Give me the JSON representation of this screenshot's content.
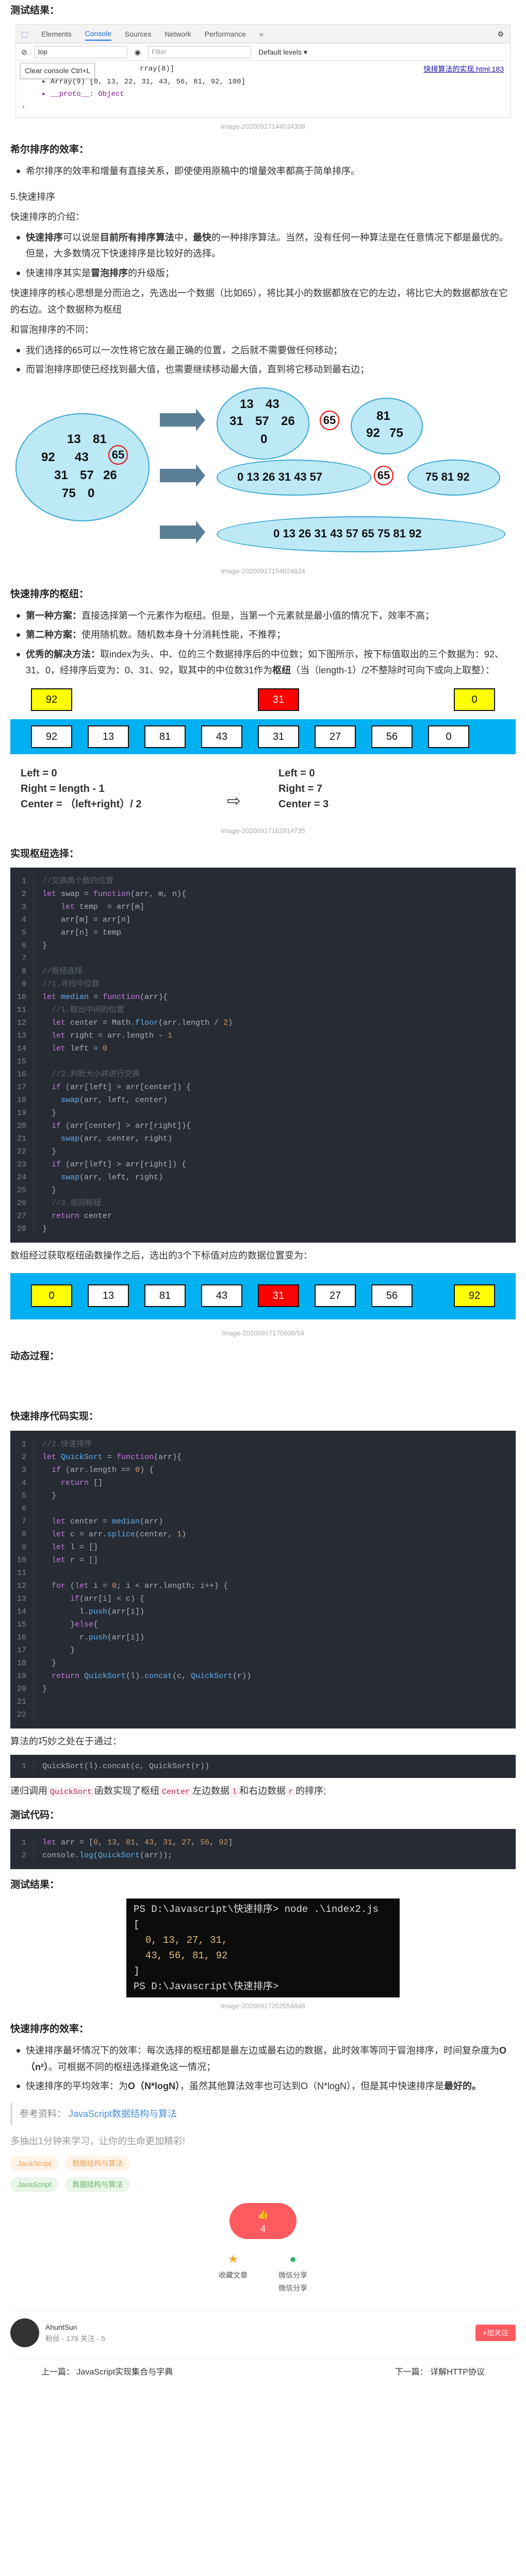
{
  "header": {
    "top_title": "测试结果："
  },
  "devtools": {
    "tabs": [
      "Elements",
      "Console",
      "Sources",
      "Network",
      "Performance"
    ],
    "more": "»",
    "context": "top",
    "filter_placeholder": "Filter",
    "levels": "Default levels ▾",
    "tooltip": "Clear console  Ctrl+L",
    "array_line": "▸ Array(9) [0, 13, 22, 31, 43, 56, 81, 92, 100]",
    "frag_top": "rray(8)]",
    "link": "快排算法的实现.html:183",
    "proto": "▸ __proto__: Object",
    "arrow": "›"
  },
  "cap1": "Image-20200917144534308",
  "s_heap": {
    "title": "希尔排序的效率：",
    "item": "希尔排序的效率和增量有直接关系，即使使用原稿中的增量效率都高于简单排序。"
  },
  "s_quick": {
    "title": "5.快速排序",
    "intro": "快速排序的介绍：",
    "b1a": "快速排序",
    "b1b": "可以说是",
    "b1c": "目前所有排序算法",
    "b1d": "中，",
    "b1e": "最快",
    "b1f": "的一种排序算法。当然，没有任何一种算法是在任意情况下都是最优的。但是，大多数情况下快速排序是比较好的选择。",
    "b2a": "快速排序其实是",
    "b2b": "冒泡排序",
    "b2c": "的升级版；",
    "p1": "快速排序的核心思想是分而治之，先选出一个数据（比如65），将比其小的数据都放在它的左边，将比它大的数据都放在它的右边。这个数据称为枢纽",
    "diff": "和冒泡排序的不同：",
    "d1": "我们选择的65可以一次性将它放在最正确的位置，之后就不需要做任何移动；",
    "d2": "而冒泡排序即使已经找到最大值，也需要继续移动最大值，直到将它移动到最右边；"
  },
  "heap_fig": {
    "g1": [
      "13",
      "81",
      "92",
      "43",
      "65",
      "31",
      "57",
      "26",
      "75",
      "0"
    ],
    "g2a": [
      "13",
      "43",
      "31",
      "57",
      "26",
      "0"
    ],
    "c1": "65",
    "g2b": [
      "81",
      "92",
      "75"
    ],
    "g3a": "0 13 26 31 43 57",
    "c2": "65",
    "g3b": "75 81 92",
    "g4": "0 13 26 31 43 57 65 75 81 92"
  },
  "cap2": "Image-20200917154024624",
  "s_pivot": {
    "title": "快速排序的枢纽：",
    "i1a": "第一种方案：",
    "i1b": "直接选择第一个元素作为枢纽。但是，当第一个元素就是最小值的情况下，效率不高；",
    "i2a": "第二种方案：",
    "i2b": "使用随机数。随机数本身十分消耗性能，不推荐；",
    "i3a": "优秀的解决方法：",
    "i3b": "取index为头、中、位的三个数据排序后的中位数；如下图所示，按下标值取出的三个数据为：92、31、0，经排序后变为：0、31、92，取其中的中位数31作为",
    "i3c": "枢纽",
    "i3d": "（当（length-1）/2不整除时可向下或向上取整）："
  },
  "box_fig": {
    "top": [
      "92",
      "31",
      "0"
    ],
    "row": [
      "92",
      "13",
      "81",
      "43",
      "31",
      "27",
      "56",
      "0"
    ],
    "left": [
      "Left = 0",
      "Right = length - 1",
      "Center = （left+right）/ 2"
    ],
    "right": [
      "Left = 0",
      "Right = 7",
      "Center = 3"
    ]
  },
  "cap3": "Image-20200917162914735",
  "s_impl": {
    "title": "实现枢纽选择："
  },
  "cap_row": "Image-20200917170908/54",
  "s_impl2": {
    "p": "数组经过获取枢纽函数操作之后，选出的3个下标值对应的数据位置变为：",
    "row2": [
      "0",
      "13",
      "81",
      "43",
      "31",
      "27",
      "56",
      "92"
    ]
  },
  "s_anim": {
    "title": "动态过程：",
    "title2": "快速排序代码实现："
  },
  "s_ret": {
    "p": "算法的巧妙之处在于通过：",
    "code": "QuickSort(l).concat(c, QuickSort(r))",
    "p2a": "递归调用",
    "p2b": "QuickSort",
    "p2c": "函数实现了枢纽",
    "p2d": "Center",
    "p2e": "左边数据",
    "p2f": "l",
    "p2g": "和右边数据",
    "p2h": "r",
    "p2i": "的排序;"
  },
  "s_test": {
    "title": "测试代码：",
    "title2": "测试结果："
  },
  "term": {
    "l1": "PS D:\\Javascript\\快速排序> node .\\index2.js",
    "l2": "[",
    "l3": "  0, 13, 27, 31,",
    "l4": "  43, 56, 81, 92",
    "l5": "]",
    "l6": "PS D:\\Javascript\\快速排序> "
  },
  "cap4": "Image-20200917202554848",
  "s_eff": {
    "title": "快速排序的效率：",
    "i1a": "快速排序最坏情况下的效率：每次选择的枢纽都是最左边或最右边的数据，此时效率等同于冒泡排序，时间复杂度为",
    "i1b": "O（n²）",
    "i1c": "。可根据不同的枢纽选择避免这一情况；",
    "i2a": "快速排序的平均效率：为",
    "i2b": "O（N*logN）",
    "i2c": "，虽然其他算法效率也可达到O（N*logN），但是其中快速排序是",
    "i2d": "最好的。"
  },
  "ref": {
    "label": "参考资料：",
    "link": "JavaScript数据结构与算法"
  },
  "slogan": "多抽出1分钟来学习，让你的生命更加精彩!",
  "tags": [
    "JavaScript",
    "数据结构与算法",
    "JavaScript",
    "数据结构与算法"
  ],
  "like": {
    "count": "4",
    "icon": "👍"
  },
  "actions": {
    "collect": "收藏文章",
    "wx1": "微信分享",
    "wx2": "微信分享"
  },
  "author": {
    "name": "AhuntSun",
    "meta": "粉丝 - 179 关注 - 5",
    "follow": "+加关注"
  },
  "nav": {
    "prev": "上一篇：  JavaScript实现集合与字典",
    "next": "下一篇：  详解HTTP协议"
  },
  "colors": {
    "yellow": "#ffff00",
    "red": "#ff0000",
    "cyan": "#00b0f0",
    "accent": "#ff5a5f"
  }
}
